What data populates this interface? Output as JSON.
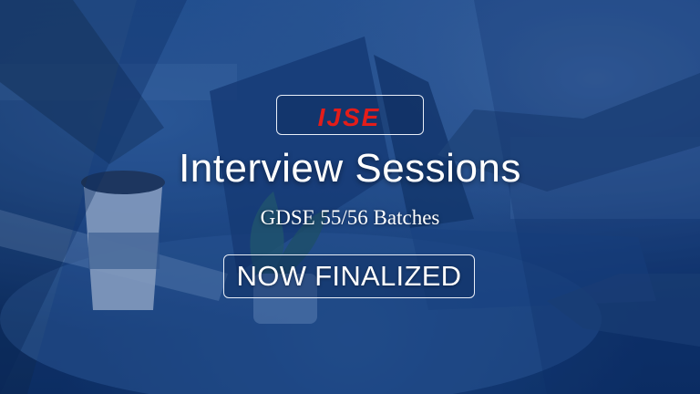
{
  "logo": {
    "text": "IJSE",
    "color": "#e31d1a"
  },
  "title": "Interview Sessions",
  "subtitle": "GDSE 55/56 Batches",
  "status": "NOW FINALIZED",
  "colors": {
    "overlay": "#0d3a7a",
    "text": "#ffffff"
  }
}
